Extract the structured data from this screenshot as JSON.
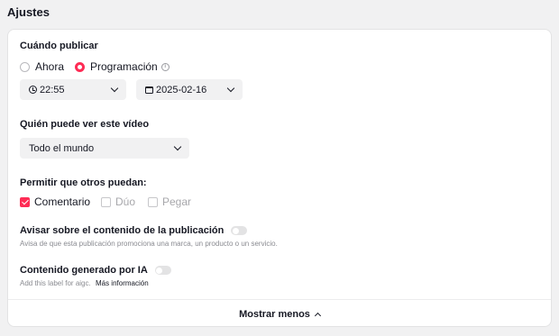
{
  "page": {
    "title": "Ajustes"
  },
  "publish": {
    "label": "Cuándo publicar",
    "options": {
      "now": "Ahora",
      "scheduled": "Programación"
    },
    "selected": "scheduled",
    "time": "22:55",
    "date": "2025-02-16"
  },
  "visibility": {
    "label": "Quién puede ver este vídeo",
    "value": "Todo el mundo"
  },
  "permissions": {
    "label": "Permitir que otros puedan:",
    "items": [
      {
        "label": "Comentario",
        "checked": true,
        "enabled": true
      },
      {
        "label": "Dúo",
        "checked": false,
        "enabled": false
      },
      {
        "label": "Pegar",
        "checked": false,
        "enabled": false
      }
    ]
  },
  "disclosure": {
    "label": "Avisar sobre el contenido de la publicación",
    "help": "Avisa de que esta publicación promociona una marca, un producto o un servicio.",
    "enabled": false
  },
  "ai": {
    "label": "Contenido generado por IA",
    "help": "Add this label for aigc.",
    "link": "Más información",
    "enabled": false
  },
  "footer": {
    "show_less": "Mostrar menos"
  },
  "colors": {
    "accent": "#fe2c55",
    "text": "#161823",
    "muted": "#8a8b91",
    "field_bg": "#f1f1f2"
  }
}
